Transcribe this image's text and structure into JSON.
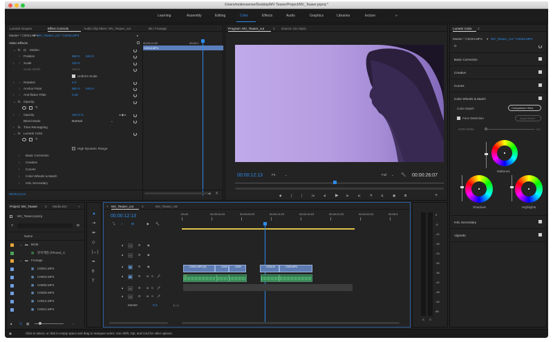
{
  "window": {
    "title": "/Users/motionsense/Desktop/MV Teaser/Project/MV_Teaser.prproj *"
  },
  "workspaces": {
    "items": [
      "Learning",
      "Assembly",
      "Editing",
      "Color",
      "Effects",
      "Audio",
      "Graphics",
      "Libraries",
      "lecture"
    ],
    "active": "Color",
    "more": "»"
  },
  "source_panel": {
    "tabs": [
      "Lumetri Scopes",
      "Effect Controls",
      "Audio Clip Mixer: MV_Teaser_cut",
      "Bin: Footage"
    ],
    "master": "Master * C0034.MP4",
    "clip": "MV_Teaser_cut * C0034.MP4",
    "ruler_start": "00;00;12;00",
    "ruler_end": "00;00;1",
    "clip_bar": "C0034.MP4",
    "video_effects": "Video Effects",
    "motion": "Motion",
    "position": {
      "label": "Position",
      "x": "960.0",
      "y": "540.0"
    },
    "scale": {
      "label": "Scale",
      "value": "100.0"
    },
    "scale_width": {
      "label": "Scale Width",
      "value": "100.0"
    },
    "uniform_scale": "Uniform Scale",
    "rotation": {
      "label": "Rotation",
      "value": "0.0"
    },
    "anchor": {
      "label": "Anchor Point",
      "x": "960.0",
      "y": "540.0"
    },
    "antiflicker": {
      "label": "Anti-flicker Filter",
      "value": "0.00"
    },
    "opacity": "Opacity",
    "opacity_row": {
      "label": "Opacity",
      "value": "100.0 %"
    },
    "blend_mode": {
      "label": "Blend Mode",
      "value": "Normal"
    },
    "time_remapping": "Time Remapping",
    "lumetri": "Lumetri Color",
    "hdr": "High Dynamic Range",
    "sections": [
      "Basic Correction",
      "Creative",
      "Curves",
      "Color Wheels & Match",
      "HSL Secondary"
    ],
    "timecode": "00;00;12;13"
  },
  "program_monitor": {
    "tabs": [
      "Program: MV_Teaser_cut",
      "Source: (no clips)"
    ],
    "timecode": "00:00:12:13",
    "fit": "Fit",
    "quality": "Full",
    "duration": "00:00:26:07"
  },
  "lumetri_panel": {
    "tab": "Lumetri Color",
    "master": "Master * C0034.MP4",
    "clip": "MV_Teaser_cut * C0034.MP4",
    "fx": "fx",
    "sections": [
      "Basic Correction",
      "Creative",
      "Curves",
      "Color Wheels & Match"
    ],
    "color_match": "Color Match",
    "comparison_view": "Comparison View",
    "face_detection": "Face Detection",
    "apply_match": "Apply Match",
    "hdr_white": "HDR White",
    "hdr_value": "100",
    "wheels": [
      "Midtones",
      "Shadows",
      "Highlights"
    ],
    "bottom_sections": [
      "HSL Secondary",
      "Vignette"
    ]
  },
  "project_panel": {
    "tabs": [
      "Project: MV_Teaser",
      "Media Bro"
    ],
    "more": "»",
    "file": "MV_Teaser.prproj",
    "name_header": "Name",
    "items": [
      {
        "name": "BGM",
        "type": "bin",
        "indent": 0,
        "color": "#e8a43a"
      },
      {
        "name": "뮤지케잉 (Phone)_C",
        "type": "audio",
        "indent": 1,
        "color": "#4aa35a"
      },
      {
        "name": "Footage",
        "type": "bin",
        "indent": 0,
        "color": "#e8a43a"
      },
      {
        "name": "C0001.MP4",
        "type": "clip",
        "indent": 1,
        "color": "#6f9fe0"
      },
      {
        "name": "C0003.MP4",
        "type": "clip",
        "indent": 1,
        "color": "#6f9fe0"
      },
      {
        "name": "C0005.MP4",
        "type": "clip",
        "indent": 1,
        "color": "#6f9fe0"
      },
      {
        "name": "C0008.MP4",
        "type": "clip",
        "indent": 1,
        "color": "#6f9fe0"
      },
      {
        "name": "C0014.MP4",
        "type": "clip",
        "indent": 1,
        "color": "#6f9fe0"
      },
      {
        "name": "C0021.MP4",
        "type": "clip",
        "indent": 1,
        "color": "#6f9fe0"
      }
    ]
  },
  "timeline": {
    "tabs": [
      "MV_Teaser_cut",
      "MV_Teaser_AE"
    ],
    "timecode": "00:00:12:13",
    "ruler": [
      ":00:00",
      "00:00:04:23",
      "00:00:09:23",
      "00:00:14:23",
      "00:00:19:23",
      "00:00:24:23",
      "00:00:29:23",
      "00:00:3"
    ],
    "video_tracks": [
      "V3",
      "V2",
      "V1"
    ],
    "audio_tracks": [
      "A1",
      "A2",
      "A3"
    ],
    "audio_buttons": [
      "M",
      "S"
    ],
    "master": "Master",
    "master_value": "0.0",
    "v1_clips": [
      "C0001.MP4 [V]",
      "C004",
      "C004",
      "C004.M",
      "C003.MP4"
    ],
    "a1_label": "fx"
  },
  "meter": {
    "scale": [
      "0",
      "-6",
      "-12",
      "-18",
      "-24",
      "-30",
      "-36",
      "-42",
      "-48",
      "-54",
      "dB"
    ],
    "footer": [
      "S",
      "S"
    ]
  },
  "status_bar": "Click to select, or click in empty space and drag to marquee select. Use Shift, Opt, and Cmd for other options.",
  "colors": {
    "accent": "#2d8ceb",
    "video_clip": "#5e7cb2",
    "audio_clip": "#2e6b4a",
    "workarea": "#e0c34a",
    "program_bg": "#b69ce0"
  }
}
